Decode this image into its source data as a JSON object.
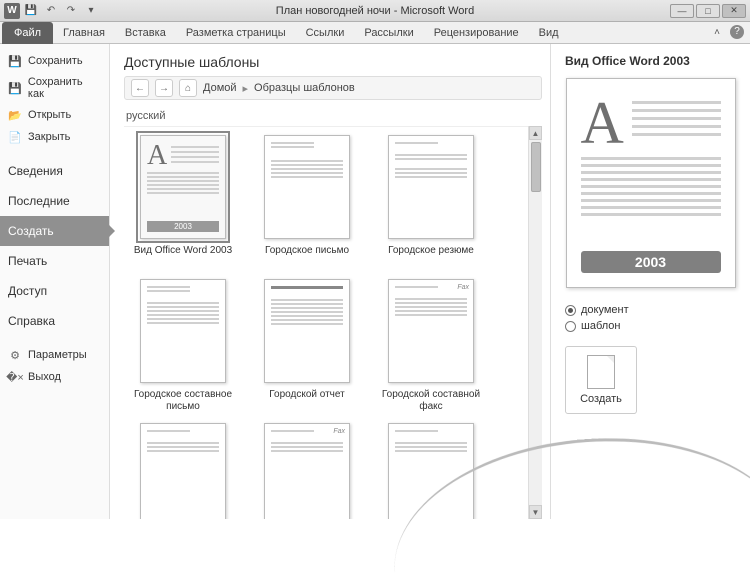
{
  "window": {
    "title": "План новогодней ночи - Microsoft Word",
    "app_letter": "W"
  },
  "ribbon": {
    "file": "Файл",
    "tabs": [
      "Главная",
      "Вставка",
      "Разметка страницы",
      "Ссылки",
      "Рассылки",
      "Рецензирование",
      "Вид"
    ]
  },
  "sidebar": {
    "save": "Сохранить",
    "save_as": "Сохранить как",
    "open": "Открыть",
    "close": "Закрыть",
    "info": "Сведения",
    "recent": "Последние",
    "new": "Создать",
    "print": "Печать",
    "share": "Доступ",
    "help": "Справка",
    "options": "Параметры",
    "exit": "Выход"
  },
  "templates": {
    "title": "Доступные шаблоны",
    "breadcrumb_home": "Домой",
    "breadcrumb_samples": "Образцы шаблонов",
    "section": "русский",
    "items": [
      {
        "label": "Вид Office Word 2003",
        "kind": "word2003"
      },
      {
        "label": "Городское письмо",
        "kind": "letter"
      },
      {
        "label": "Городское резюме",
        "kind": "resume"
      },
      {
        "label": "Городское составное письмо",
        "kind": "merge-letter"
      },
      {
        "label": "Городской отчет",
        "kind": "report"
      },
      {
        "label": "Городской составной факс",
        "kind": "merge-fax"
      },
      {
        "label": "",
        "kind": "generic"
      },
      {
        "label": "",
        "kind": "fax"
      },
      {
        "label": "",
        "kind": "generic"
      }
    ]
  },
  "preview": {
    "title": "Вид Office Word 2003",
    "year": "2003",
    "radio_document": "документ",
    "radio_template": "шаблон",
    "create": "Создать"
  }
}
